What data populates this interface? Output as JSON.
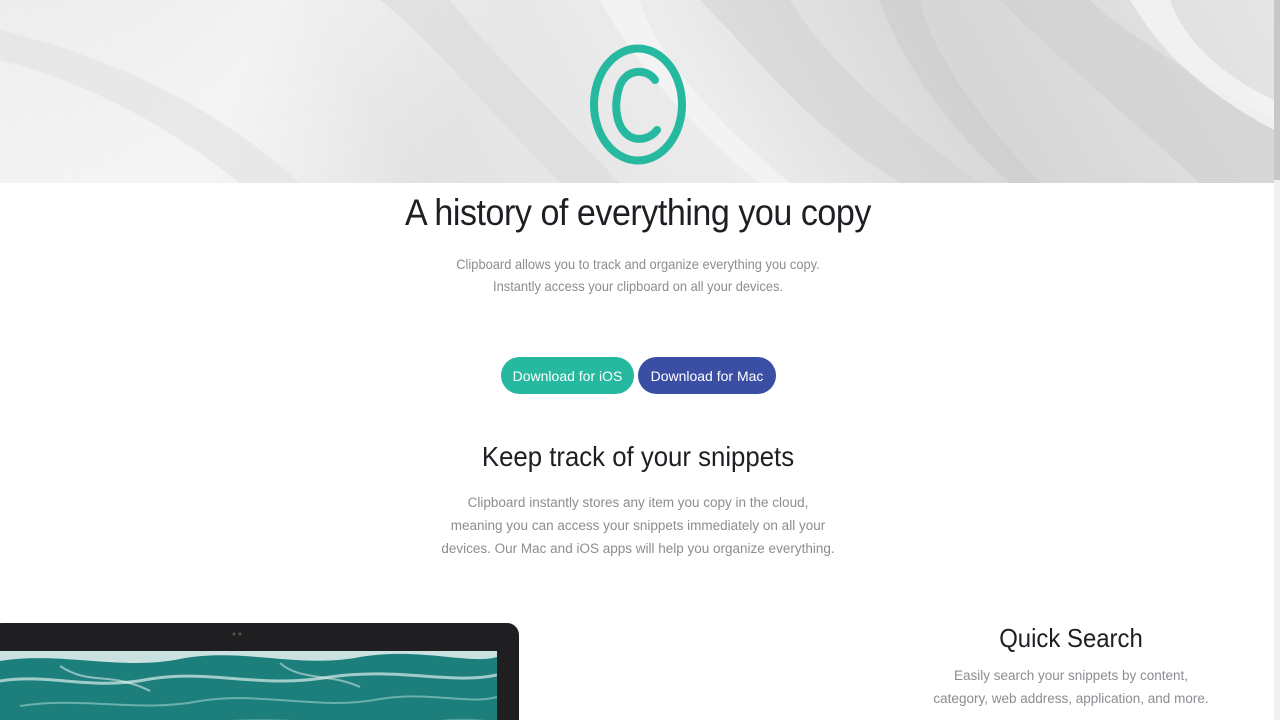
{
  "hero": {
    "logo_icon": "copyright-circle-icon",
    "accent": "#26b9a0"
  },
  "headline": "A history of everything you copy",
  "subtext": {
    "line1": "Clipboard allows you to track and organize everything you copy.",
    "line2": "Instantly access your clipboard on all your devices."
  },
  "buttons": {
    "ios_label": "Download for iOS",
    "mac_label": "Download for Mac",
    "ios_color": "#26b9a0",
    "mac_color": "#3a4fa3"
  },
  "snippets": {
    "title": "Keep track of your snippets",
    "text": "Clipboard instantly stores any item you copy in the cloud, meaning you can access your snippets immediately on all your devices. Our Mac and iOS apps will help you organize everything."
  },
  "feature": {
    "title": "Quick Search",
    "text": "Easily search your snippets by content, category, web address, application, and more."
  }
}
